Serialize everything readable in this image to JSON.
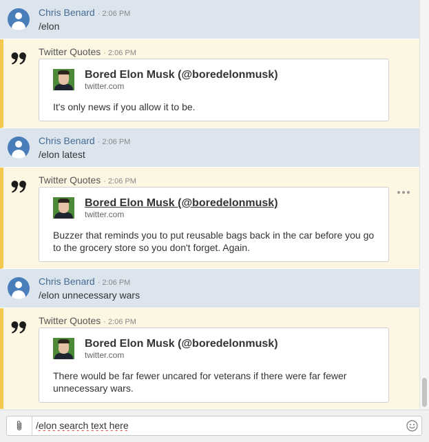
{
  "messages": [
    {
      "kind": "user",
      "sender": "Chris Benard",
      "separator": "·",
      "time": "2:06 PM",
      "text": "/elon"
    },
    {
      "kind": "bot",
      "sender": "Twitter Quotes",
      "separator": "·",
      "time": "2:06 PM",
      "card": {
        "title": "Bored Elon Musk (@boredelonmusk)",
        "domain": "twitter.com",
        "text": "It's only news if you allow it to be."
      }
    },
    {
      "kind": "user",
      "sender": "Chris Benard",
      "separator": "·",
      "time": "2:06 PM",
      "text": "/elon latest"
    },
    {
      "kind": "bot",
      "sender": "Twitter Quotes",
      "separator": "·",
      "time": "2:06 PM",
      "card": {
        "title": "Bored Elon Musk (@boredelonmusk)",
        "domain": "twitter.com",
        "text": "Buzzer that reminds you to put reusable bags back in the car before you go to the grocery store so you don't forget. Again."
      }
    },
    {
      "kind": "user",
      "sender": "Chris Benard",
      "separator": "·",
      "time": "2:06 PM",
      "text": "/elon unnecessary wars"
    },
    {
      "kind": "bot",
      "sender": "Twitter Quotes",
      "separator": "·",
      "time": "2:06 PM",
      "card": {
        "title": "Bored Elon Musk (@boredelonmusk)",
        "domain": "twitter.com",
        "text": "There would be far fewer uncared for veterans if there were far fewer unnecessary wars."
      }
    }
  ],
  "composer": {
    "value": "/elon search text here",
    "attach_icon": "paperclip-icon",
    "emoji_icon": "smiley-icon"
  },
  "colors": {
    "user_row_bg": "#dce5ee",
    "bot_row_bg": "#fdf6e2",
    "bot_accent": "#f2c94c",
    "avatar": "#4a7ebb",
    "sender_link": "#446b92"
  }
}
